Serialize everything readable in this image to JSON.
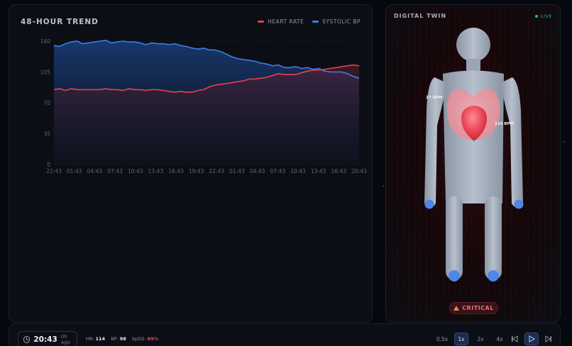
{
  "trend": {
    "title": "48-HOUR TREND",
    "legend": [
      {
        "label": "HEART RATE",
        "color": "#e8404f"
      },
      {
        "label": "SYSTOLIC BP",
        "color": "#3f7fe8"
      }
    ]
  },
  "chart_data": {
    "type": "area",
    "title": "48-HOUR TREND",
    "xlabel": "",
    "ylabel": "",
    "ylim": [
      0,
      140
    ],
    "yticks": [
      0,
      35,
      70,
      105,
      140
    ],
    "grid": true,
    "legend_position": "top-right",
    "x_tick_labels": [
      "22:43",
      "01:43",
      "04:43",
      "07:43",
      "10:43",
      "13:43",
      "16:43",
      "19:43",
      "22:43",
      "01:43",
      "04:43",
      "07:43",
      "10:43",
      "13:43",
      "16:43",
      "20:43"
    ],
    "series": [
      {
        "name": "SYSTOLIC BP",
        "color": "#3f7fe8",
        "values": [
          135,
          134,
          137,
          139,
          140,
          137,
          138,
          139,
          140,
          141,
          138,
          139,
          140,
          139,
          139,
          138,
          136,
          138,
          137,
          137,
          136,
          137,
          135,
          134,
          132,
          131,
          132,
          130,
          130,
          128,
          125,
          122,
          120,
          119,
          118,
          117,
          115,
          114,
          112,
          113,
          110,
          110,
          111,
          109,
          110,
          108,
          109,
          106,
          105,
          105,
          105,
          103,
          100,
          98
        ]
      },
      {
        "name": "HEART RATE",
        "color": "#e8404f",
        "values": [
          85,
          86,
          84,
          86,
          85,
          85,
          85,
          85,
          85,
          86,
          85,
          85,
          84,
          86,
          85,
          85,
          84,
          85,
          85,
          84,
          83,
          82,
          83,
          82,
          82,
          84,
          85,
          88,
          90,
          91,
          92,
          93,
          94,
          95,
          97,
          97,
          98,
          99,
          101,
          103,
          102,
          102,
          102,
          104,
          106,
          107,
          107,
          108,
          109,
          110,
          111,
          112,
          113,
          112
        ]
      }
    ]
  },
  "twin": {
    "title": "DIGITAL TWIN",
    "live_label": "LIVE",
    "resp_label": "27 RPM",
    "hr_label": "114 BPM",
    "status_label": "CRITICAL",
    "colors": {
      "critical": "#e5706f",
      "live": "#22c08a",
      "heart": "#e8404f"
    }
  },
  "playback": {
    "time": "20:43",
    "ago": "0h ago",
    "hr_label": "HR:",
    "hr_value": "114",
    "bp_label": "BP:",
    "bp_value": "98",
    "spo2_label": "SpO2:",
    "spo2_value": "89%",
    "speeds": [
      "0.5x",
      "1x",
      "2x",
      "4x"
    ],
    "active_speed": "1x"
  }
}
